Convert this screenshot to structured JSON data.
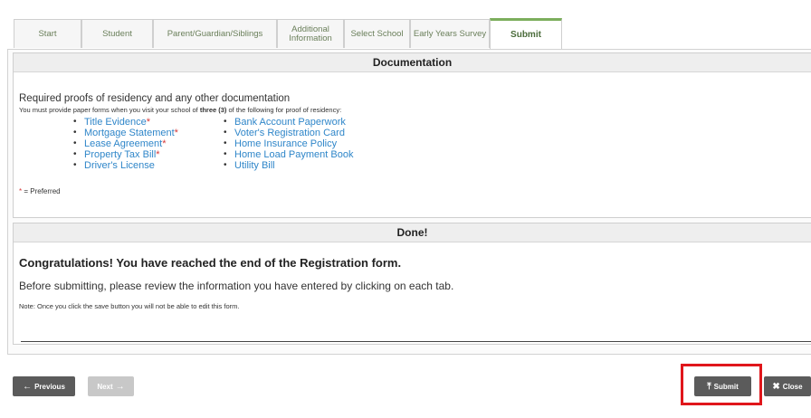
{
  "tabs": [
    {
      "label": "Start"
    },
    {
      "label": "Student"
    },
    {
      "label": "Parent/Guardian/Siblings"
    },
    {
      "label": "Additional Information"
    },
    {
      "label": "Select School"
    },
    {
      "label": "Early Years Survey"
    },
    {
      "label": "Submit"
    }
  ],
  "active_tab": "Submit",
  "documentation": {
    "header": "Documentation",
    "intro": "Required proofs of residency and any other documentation",
    "instruction_prefix": "You must provide paper forms when you visit your school of ",
    "instruction_bold": "three (3)",
    "instruction_suffix": " of the following for proof of residency:",
    "left_items": [
      {
        "label": "Title Evidence",
        "mark": "*"
      },
      {
        "label": "Mortgage Statement",
        "mark": "*"
      },
      {
        "label": "Lease Agreement",
        "mark": "*"
      },
      {
        "label": "Property Tax Bill",
        "mark": "*"
      },
      {
        "label": "Driver's License",
        "mark": ""
      }
    ],
    "right_items": [
      {
        "label": "Bank Account Paperwork"
      },
      {
        "label": "Voter's Registration Card"
      },
      {
        "label": "Home Insurance Policy"
      },
      {
        "label": "Home Load Payment Book"
      },
      {
        "label": "Utility Bill"
      }
    ],
    "preferred_mark": "*",
    "preferred_text": " = Preferred"
  },
  "done": {
    "header": "Done!",
    "title": "Congratulations! You have reached the end of the Registration form.",
    "text": "Before submitting, please review the information you have entered by clicking on each tab.",
    "note": "Note: Once you click the save button you will not be able to edit this form."
  },
  "buttons": {
    "previous": "Previous",
    "next": "Next",
    "submit": "Submit",
    "close": "Close"
  },
  "colors": {
    "accent": "#7cae5c",
    "link": "#2f86c9",
    "required": "#d63a3a",
    "highlight": "#e0161b"
  }
}
